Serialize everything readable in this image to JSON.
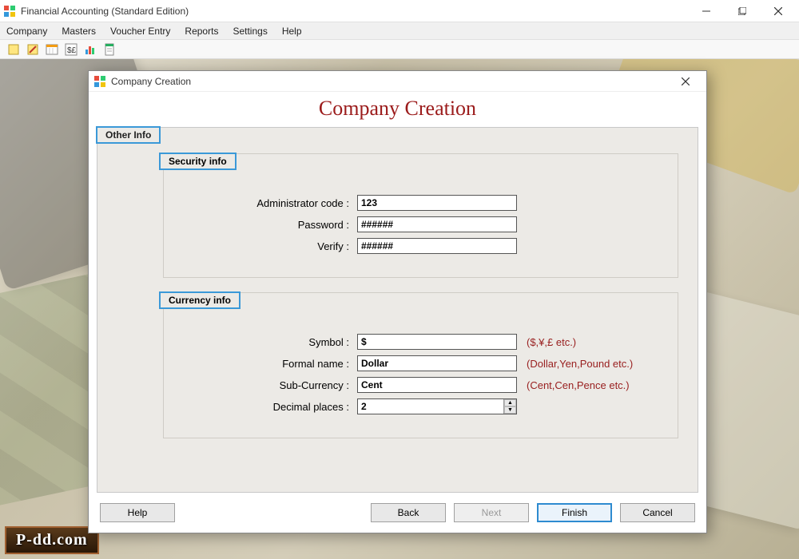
{
  "app": {
    "title": "Financial Accounting (Standard Edition)"
  },
  "menu": {
    "company": "Company",
    "masters": "Masters",
    "voucher": "Voucher Entry",
    "reports": "Reports",
    "settings": "Settings",
    "help": "Help"
  },
  "dialog": {
    "title": "Company Creation",
    "heading": "Company Creation",
    "tab_other": "Other Info",
    "group_security": "Security info",
    "group_currency": "Currency info",
    "labels": {
      "admin_code": "Administrator code :",
      "password": "Password :",
      "verify": "Verify :",
      "symbol": "Symbol :",
      "formal_name": "Formal name :",
      "sub_currency": "Sub-Currency :",
      "decimal_places": "Decimal places :"
    },
    "values": {
      "admin_code": "123",
      "password": "######",
      "verify": "######",
      "symbol": "$",
      "formal_name": "Dollar",
      "sub_currency": "Cent",
      "decimal_places": "2"
    },
    "hints": {
      "symbol": "($,¥,£ etc.)",
      "formal_name": "(Dollar,Yen,Pound etc.)",
      "sub_currency": "(Cent,Cen,Pence etc.)"
    },
    "buttons": {
      "help": "Help",
      "back": "Back",
      "next": "Next",
      "finish": "Finish",
      "cancel": "Cancel"
    }
  },
  "watermark": "P-dd.com"
}
